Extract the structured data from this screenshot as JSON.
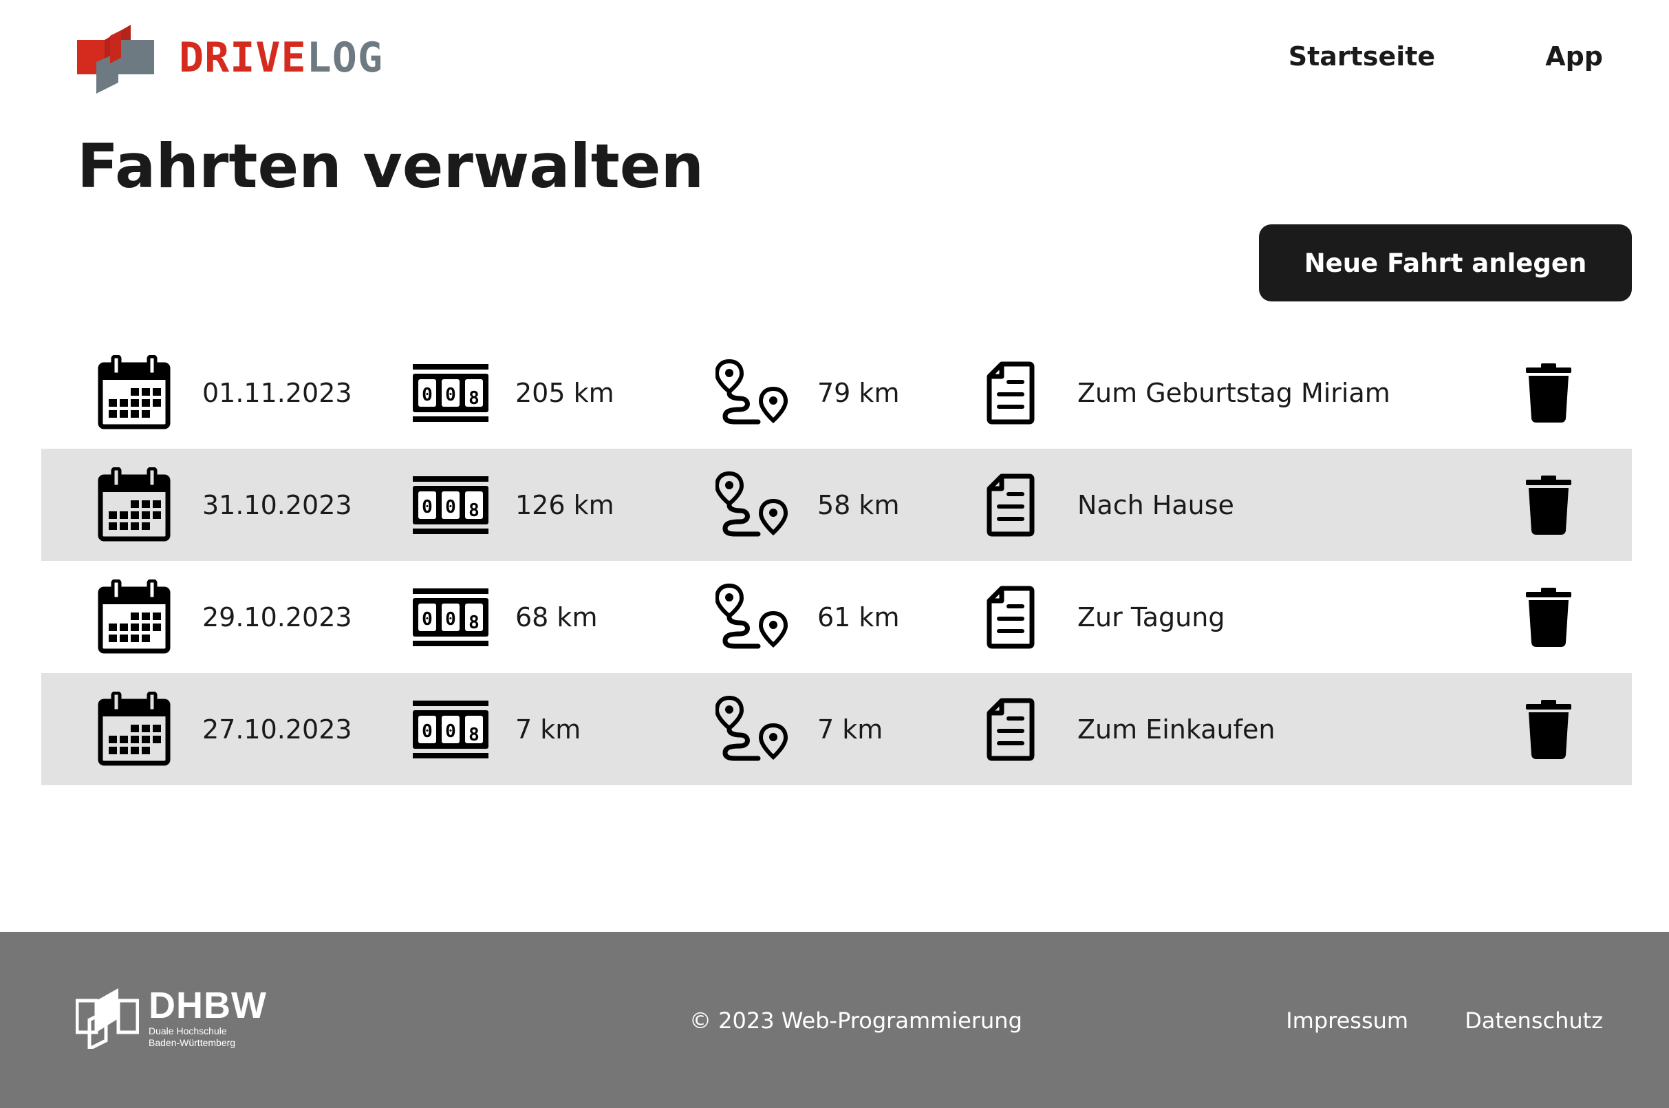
{
  "brand": {
    "name_part1": "DRIVE",
    "name_part2": "LOG",
    "color_red": "#d52b1e",
    "color_gray": "#6e7a82"
  },
  "nav": {
    "items": [
      {
        "label": "Startseite"
      },
      {
        "label": "App"
      }
    ]
  },
  "page": {
    "title": "Fahrten verwalten",
    "new_button_label": "Neue Fahrt anlegen"
  },
  "trips": [
    {
      "date": "01.11.2023",
      "odometer": "205 km",
      "distance": "79 km",
      "note": "Zum Geburtstag Miriam"
    },
    {
      "date": "31.10.2023",
      "odometer": "126 km",
      "distance": "58 km",
      "note": "Nach Hause"
    },
    {
      "date": "29.10.2023",
      "odometer": "68 km",
      "distance": "61 km",
      "note": "Zur Tagung"
    },
    {
      "date": "27.10.2023",
      "odometer": "7 km",
      "distance": "7 km",
      "note": "Zum Einkaufen"
    }
  ],
  "icons": {
    "date": "calendar-icon",
    "odometer": "odometer-icon",
    "distance": "route-icon",
    "note": "document-icon",
    "delete": "trash-icon"
  },
  "footer": {
    "logo_name": "DHBW",
    "logo_sub": "Duale Hochschule Baden-Württemberg",
    "copyright": "© 2023 Web-Programmierung",
    "links": [
      {
        "label": "Impressum"
      },
      {
        "label": "Datenschutz"
      }
    ],
    "background": "#767676"
  }
}
